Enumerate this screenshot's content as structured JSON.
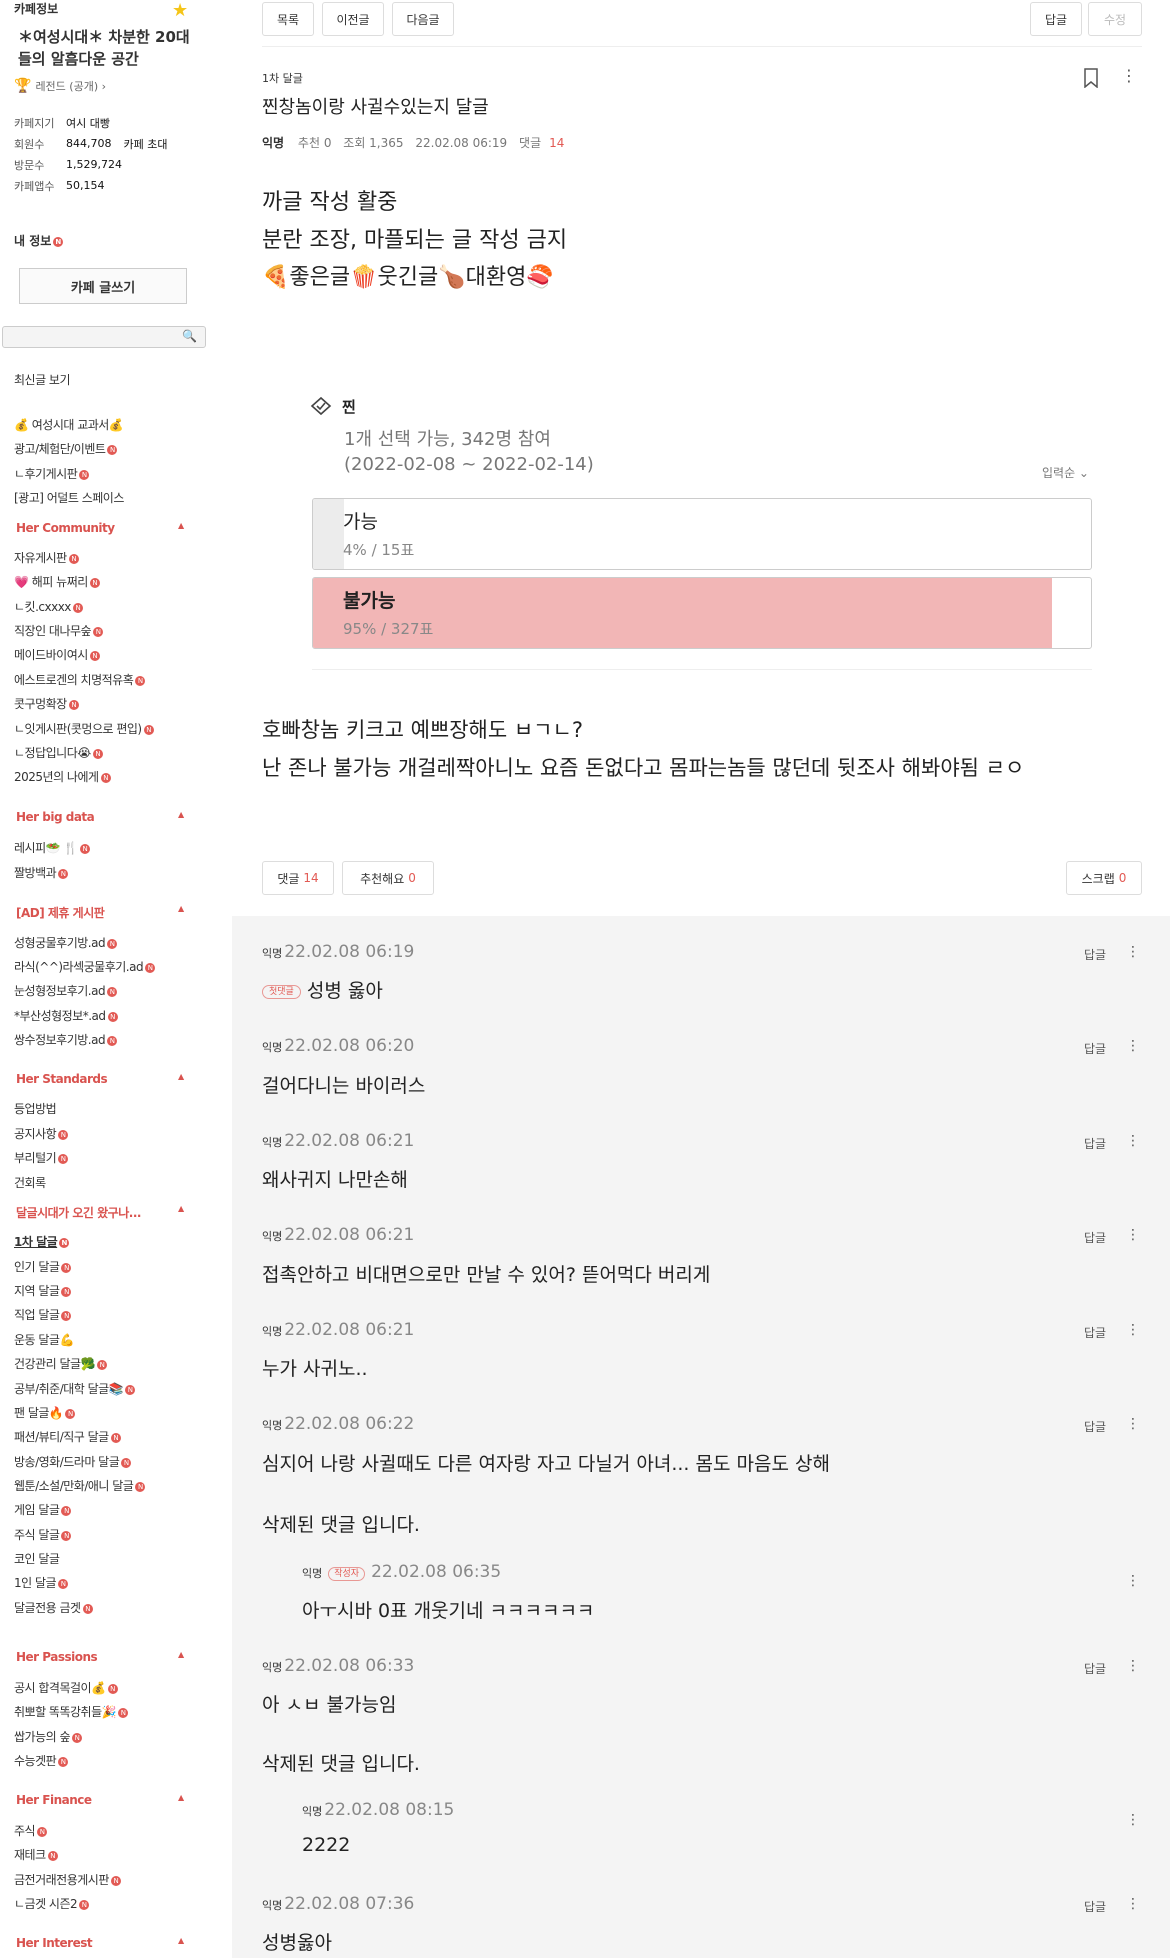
{
  "sidebar": {
    "title": "카페정보",
    "cafe_name": "＊여성시대＊ 차분한 20대들의 알흠다운 공간",
    "grade": "레전드 (공개) ›",
    "stats": {
      "manager_label": "카페지기",
      "manager_value": "여시 대빵",
      "members_label": "회원수",
      "members_value": "844,708",
      "invite": "카페 초대",
      "visitors_label": "방문수",
      "visitors_value": "1,529,724",
      "apps_label": "카페앱수",
      "apps_value": "50,154"
    },
    "my_info": "내 정보",
    "write_button": "카페 글쓰기",
    "search_placeholder": "",
    "items": {
      "recent": "최신글 보기",
      "textbook": "💰 여성시대 교과서💰",
      "ad": "광고/체험단/이벤트",
      "review": "ㄴ후기게시판",
      "adult": "[광고] 어덜트 스페이스",
      "sec_community": "Her Community",
      "free": "자유게시판",
      "happy": "💗 해피 뉴쩌리",
      "cut": "ㄴ킷.cxxxx",
      "office": "직장인 대나무숲",
      "maid": "메이드바이여시",
      "estrogen": "에스트로겐의 치명적유혹",
      "vent": "콧구멍확장",
      "hangout": "ㄴ잇게시판(콧멍으로 편입)",
      "answer": "ㄴ정답입니다😭",
      "y2025": "2025년의 나에게",
      "sec_bigdata": "Her big data",
      "recipe": "레시피🥗 🍴",
      "jjal": "짤방백과",
      "sec_ad": "[AD] 제휴 게시판",
      "plastic": "성형궁물후기방.ad",
      "lasik": "라식(^^)라섹궁물후기.ad",
      "eye": "눈성형정보후기.ad",
      "busan": "*부산성형정보*.ad",
      "eyelid": "쌍수정보후기방.ad",
      "sec_standards": "Her Standards",
      "levelup": "등업방법",
      "notice": "공지사항",
      "vent2": "부리털기",
      "suggest": "건회록",
      "sec_dalgeul": "달글시대가 오긴 왔구나...",
      "d1": "1차 달글",
      "d_pop": "인기 달글",
      "d_region": "지역 달글",
      "d_job": "직업 달글",
      "d_exercise": "운동 달글💪",
      "d_health": "건강관리 달글🥦",
      "d_study": "공부/취준/대학 달글📚",
      "d_fan": "팬 달글🔥",
      "d_fashion": "패션/뷰티/직구 달글",
      "d_drama": "방송/영화/드라마 달글",
      "d_webtoon": "웹툰/소설/만화/애니 달글",
      "d_game": "게임 달글",
      "d_stock": "주식 달글",
      "d_coin": "코인 달글",
      "d_single": "1인 달글",
      "d_goods": "달글전용 금겟",
      "sec_passions": "Her Passions",
      "exam": "공시 합격목걸이💰",
      "jobs": "취뽀할 똑똑강취들🎉",
      "forest": "쌉가능의 숲",
      "suneung": "수능겟판",
      "sec_finance": "Her Finance",
      "stock": "주식",
      "finance": "재테크",
      "gold": "금전거래전용게시판",
      "gold2": "ㄴ금겟 시즌2",
      "sec_interest": "Her Interest",
      "new_badge": "N"
    }
  },
  "topbar": {
    "list": "목록",
    "prev": "이전글",
    "next": "다음글",
    "reply": "답글",
    "edit": "수정"
  },
  "post": {
    "board": "1차 달글",
    "title": "찐창놈이랑 사귈수있는지 달글",
    "author": "익명",
    "recommend": "추천 0",
    "views": "조회 1,365",
    "date": "22.02.08 06:19",
    "comments_label": "댓글",
    "comments_count": "14",
    "body1": "까글 작성 활중",
    "body2": "분란 조장, 마플되는 글 작성 금지",
    "body3": "🍕좋은글🍿웃긴글🍗대환영🍣",
    "body4": "호빠창놈 키크고 예쁘장해도 ㅂㄱㄴ?",
    "body5": "난 존나 불가능 개걸레짝아니노 요즘 돈없다고 몸파는놈들 많던데 뒷조사 해봐야됨 ㄹㅇ"
  },
  "poll": {
    "title": "찐",
    "info": "1개 선택 가능, 342명 참여",
    "period": "(2022-02-08 ~ 2022-02-14)",
    "sort": "입력순 ⌄",
    "options": [
      {
        "label": "가능",
        "result": "4% / 15표",
        "fraction": 0.04,
        "color": "#ececec"
      },
      {
        "label": "불가능",
        "result": "95% / 327표",
        "fraction": 0.95,
        "color": "#f2b6b6"
      }
    ]
  },
  "actions": {
    "comment": "댓글",
    "comment_count": "14",
    "like": "추천해요",
    "like_count": "0",
    "scrap": "스크랩",
    "scrap_count": "0"
  },
  "comments": {
    "reply_label": "답글",
    "first_tag": "첫댓글",
    "writer_tag": "작성자",
    "c1": {
      "author": "익명",
      "date": "22.02.08 06:19",
      "text": "성병 옳아"
    },
    "c2": {
      "author": "익명",
      "date": "22.02.08 06:20",
      "text": "걸어다니는 바이러스"
    },
    "c3": {
      "author": "익명",
      "date": "22.02.08 06:21",
      "text": "왜사귀지 나만손해"
    },
    "c4": {
      "author": "익명",
      "date": "22.02.08 06:21",
      "text": "접촉안하고 비대면으로만 만날 수 있어? 뜯어먹다 버리게"
    },
    "c5": {
      "author": "익명",
      "date": "22.02.08 06:21",
      "text": "누가 사귀노.."
    },
    "c6": {
      "author": "익명",
      "date": "22.02.08 06:22",
      "text": "심지어 나랑 사귈때도 다른 여자랑 자고 다닐거 아녀... 몸도 마음도 상해"
    },
    "deleted1": "삭제된 댓글 입니다.",
    "r1": {
      "author": "익명",
      "date": "22.02.08 06:35",
      "text": "아ㅜ시바 0표 개웃기네 ㅋㅋㅋㅋㅋㅋ"
    },
    "c7": {
      "author": "익명",
      "date": "22.02.08 06:33",
      "text": "아 ㅅㅂ 불가능임"
    },
    "deleted2": "삭제된 댓글 입니다.",
    "r2": {
      "author": "익명",
      "date": "22.02.08 08:15",
      "text": "2222"
    },
    "c8": {
      "author": "익명",
      "date": "22.02.08 07:36",
      "text": "성병옳아"
    }
  }
}
